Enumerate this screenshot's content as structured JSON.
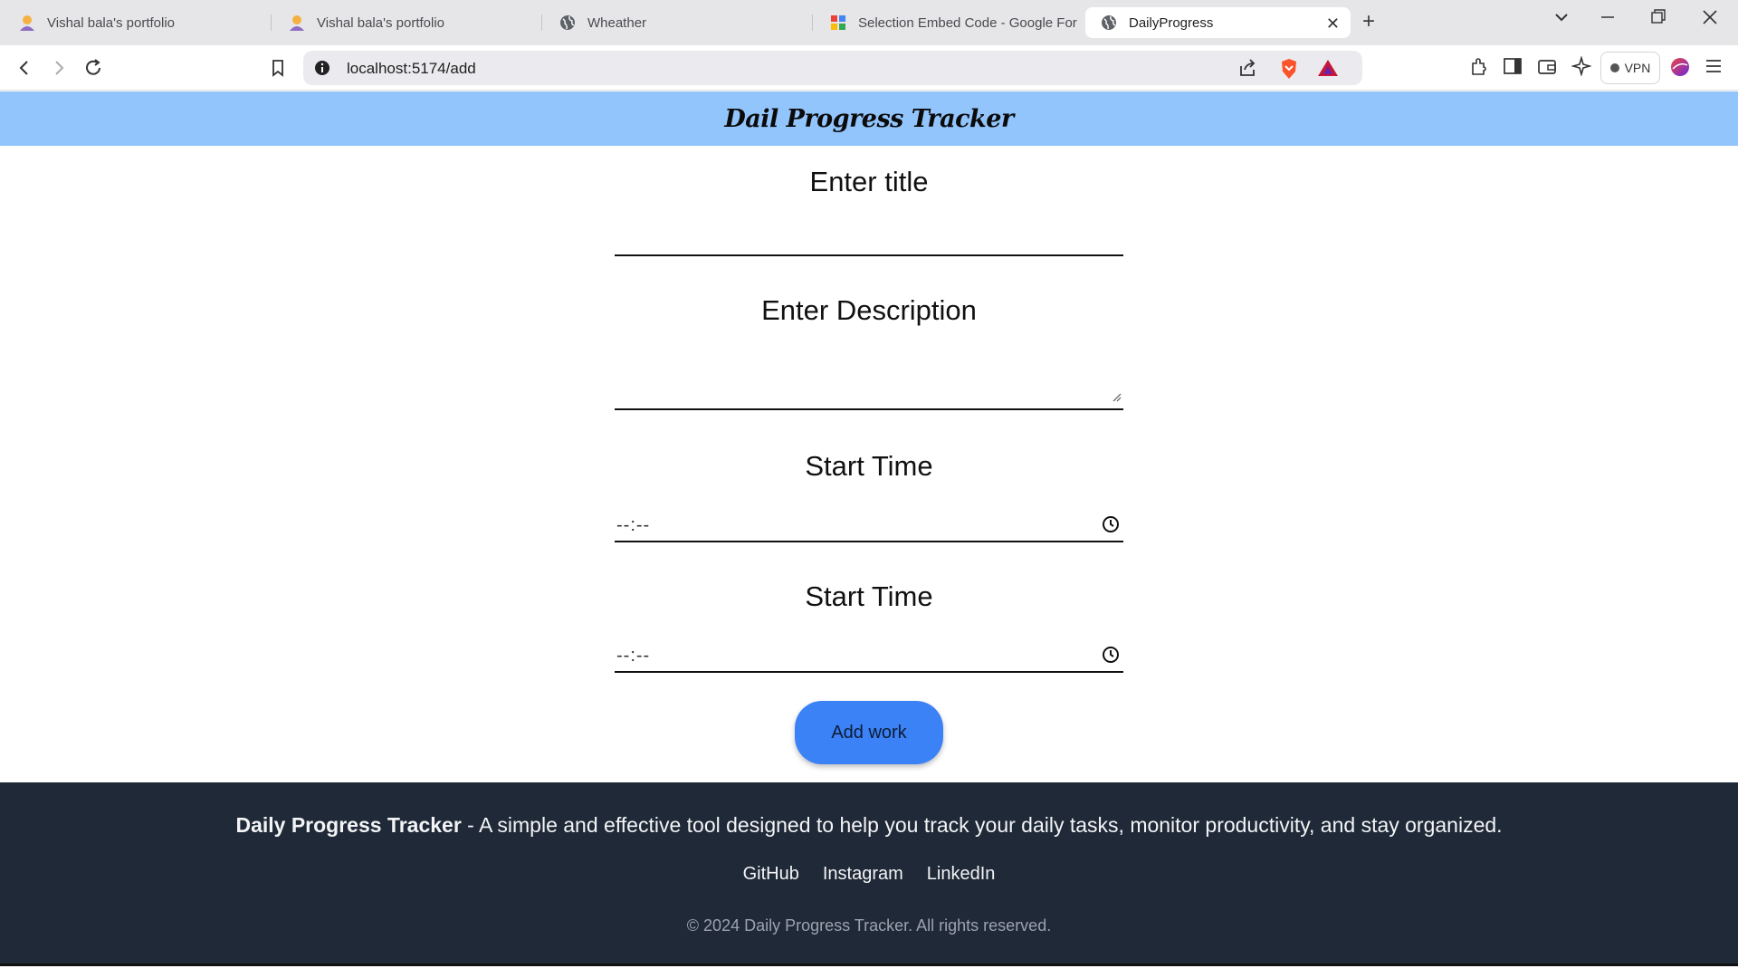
{
  "browser": {
    "tabs": [
      {
        "label": "Vishal bala's portfolio",
        "icon": "avatar-icon",
        "active": false
      },
      {
        "label": "Vishal bala's portfolio",
        "icon": "avatar-icon",
        "active": false
      },
      {
        "label": "Wheather",
        "icon": "globe-icon",
        "active": false
      },
      {
        "label": "Selection Embed Code - Google For",
        "icon": "google-icon",
        "active": false
      },
      {
        "label": "DailyProgress",
        "icon": "globe-icon",
        "active": true
      }
    ],
    "url": "localhost:5174/add",
    "vpn_label": "VPN"
  },
  "header": {
    "title": "Dail Progress Tracker",
    "background": "#93c5fd"
  },
  "form": {
    "title_label": "Enter title",
    "description_label": "Enter Description",
    "start_time_label": "Start Time",
    "end_time_label": "Start Time",
    "time_placeholder": "--:--",
    "submit_label": "Add work",
    "button_color": "#3b82f6"
  },
  "footer": {
    "brand": "Daily Progress Tracker",
    "tagline": " - A simple and effective tool designed to help you track your daily tasks, monitor productivity, and stay organized.",
    "links": [
      "GitHub",
      "Instagram",
      "LinkedIn"
    ],
    "copyright": "© 2024 Daily Progress Tracker. All rights reserved.",
    "background": "#1f2937"
  }
}
